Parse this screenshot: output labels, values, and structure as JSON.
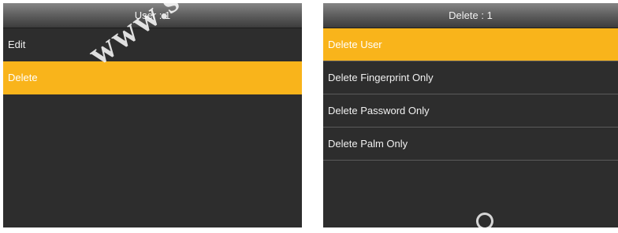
{
  "left_screen": {
    "title": "User : 1",
    "items": [
      {
        "label": "Edit"
      },
      {
        "label": "Delete"
      }
    ],
    "selected_index": 1
  },
  "right_screen": {
    "title": "Delete : 1",
    "items": [
      {
        "label": "Delete User"
      },
      {
        "label": "Delete Fingerprint Only"
      },
      {
        "label": "Delete Password Only"
      },
      {
        "label": "Delete Palm Only"
      }
    ],
    "selected_index": 0
  },
  "watermark": "www.sec.u",
  "colors": {
    "highlight": "#f9b41b",
    "background": "#2d2d2d",
    "title_gradient_top": "#858585",
    "title_gradient_bottom": "#3c3c3c"
  }
}
